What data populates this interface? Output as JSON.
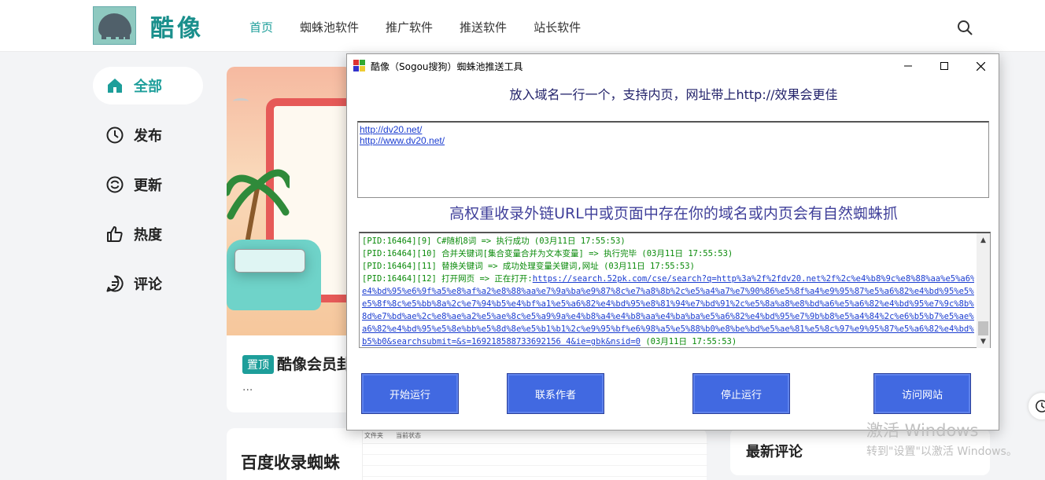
{
  "site": {
    "logo_text": "酷像",
    "nav": [
      "首页",
      "蜘蛛池软件",
      "推广软件",
      "推送软件",
      "站长软件"
    ],
    "sidebar": [
      "全部",
      "发布",
      "更新",
      "热度",
      "评论"
    ]
  },
  "main": {
    "card1": {
      "pin": "置顶",
      "title": "酷像会员卦",
      "excerpt": "..."
    },
    "card2": {
      "title": "百度收录蜘蛛",
      "col1": "文件夹",
      "col2": "当前状态"
    },
    "card3": {
      "title": "最新评论"
    }
  },
  "dialog": {
    "title": "酷像（Sogou搜狗）蜘蛛池推送工具",
    "hint_top": "放入域名一行一个，支持内页，网址带上http://效果会更佳",
    "urls": [
      "http://dv20.net/",
      "http://www.dv20.net/"
    ],
    "hint_mid": "高权重收录外链URL中或页面中存在你的域名或内页会有自然蜘蛛抓",
    "log": [
      "[PID:16464][9] C#随机8词 => 执行成功 (03月11日 17:55:53)",
      "[PID:16464][10] 合并关键词[集合变量合并为文本变量] => 执行完毕 (03月11日 17:55:53)",
      "[PID:16464][11] 替换关键词 => 成功处理变量关键词,网址 (03月11日 17:55:53)",
      "[PID:16464][12] 打开网页 => 正在打开:"
    ],
    "log_url_lines": [
      "https://search.52pk.com/cse/search?q=http%3a%2f%2fdv20.net%2f%2c%e4%b8%9c%e8%88%aa%e5%a6%82%",
      "e4%bd%95%e6%9f%a5%e8%af%a2%e8%88%aa%e7%9a%ba%e9%87%8c%e7%a8%8b%2c%e5%a4%a7%e7%90%86%e5%8f%a4%e9%95%87%e5%a6%82%e4%bd%95%e5%88%b0%",
      "e5%8f%8c%e5%bb%8a%2c%e7%94%b5%e4%bf%a1%e5%a6%82%e4%bd%95%e8%81%94%e7%bd%91%2c%e5%8a%a8%e8%bd%a6%e5%a6%82%e4%bd%95%e7%9c%8b%e4%bd%",
      "8d%e7%bd%ae%2c%e8%ae%a2%e5%ae%8c%e5%a9%9a%e4%b8%a4%e4%b8%aa%e4%ba%ba%e5%a6%82%e4%bd%95%e7%9b%b8%e5%a4%84%2c%e6%b5%b7%e5%ae%81%e5%",
      "a6%82%e4%bd%95%e5%8e%bb%e5%8d%8e%e5%b1%b1%2c%e9%95%bf%e6%98%a5%e5%88%b0%e8%be%bd%e5%ae%81%e5%8c%97%e9%95%87%e5%a6%82%e4%bd%95%e8%",
      "b5%b0&searchsubmit=&s=169218588733692156 4&ie=gbk&nsid=0"
    ],
    "log_tail": " (03月11日 17:55:53)",
    "buttons": [
      "开始运行",
      "联系作者",
      "停止运行",
      "访问网站"
    ]
  },
  "system": {
    "activate_line1": "激活 Windows",
    "activate_line2": "转到\"设置\"以激活 Windows。"
  },
  "colors": {
    "accent": "#1d9e9a",
    "dialog_button": "#4169e1",
    "log_text": "#0a8a0a"
  }
}
